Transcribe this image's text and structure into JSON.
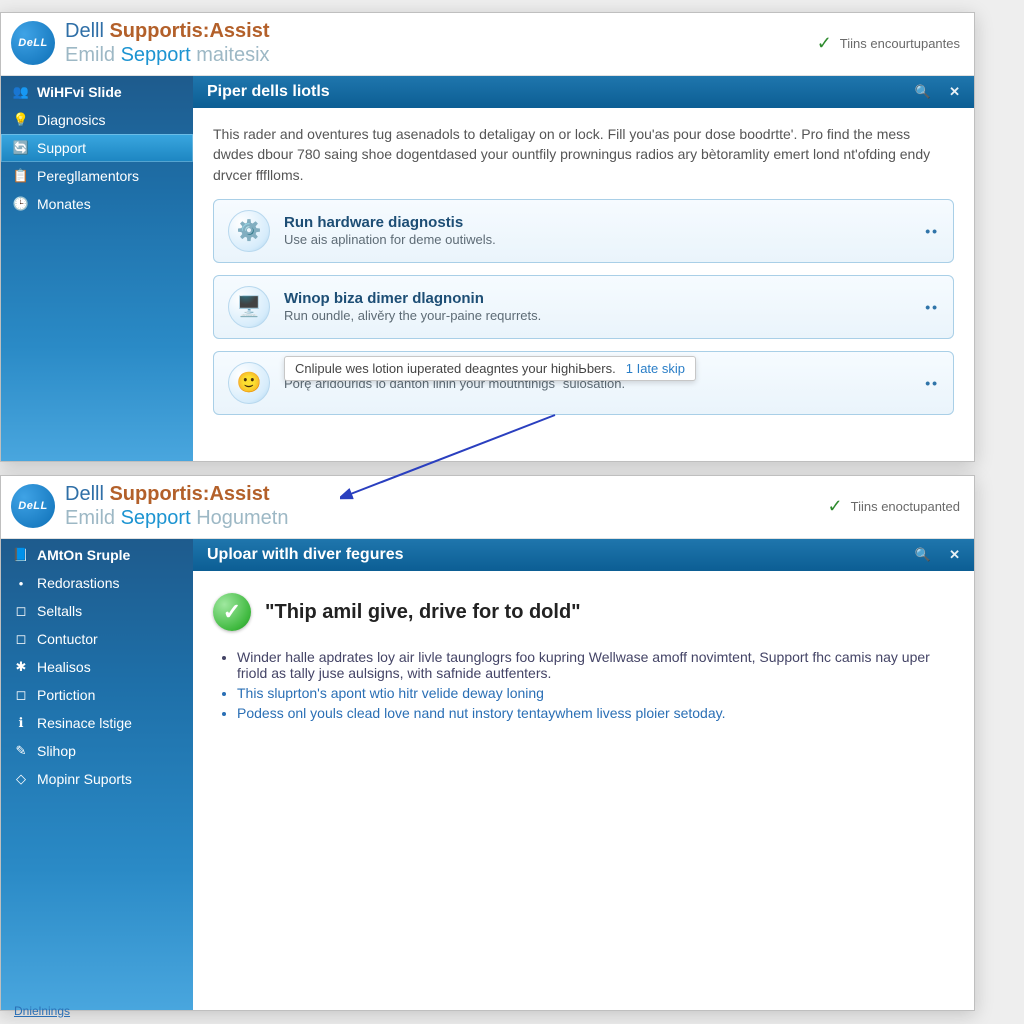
{
  "colors": {
    "accent": "#1d6fa8",
    "link": "#2a6fb5"
  },
  "top": {
    "logo": "DeLL",
    "title_brand": "Delll ",
    "title_app": "Supportis:Assist",
    "subtitle_pre": "Emild ",
    "subtitle_main": "Sepport ",
    "subtitle_post": "maitesix",
    "status_icon": "✓",
    "status_text": "Tiins encourtupantes",
    "pane_title": "Piper dells liotls",
    "intro": "This rader and oventures tug asenadols to detaligay on or lock. Fill you'as pour dose boodrtte'. Pro find the mess dwdes dbour 780 saing shoe dogentdased your ountfily prowningus radios ary bètoramlity emert lond nt'ofding endy drvcer ffflloms.",
    "sidebar": [
      {
        "icon": "👥",
        "label": "WiHFvi Slide"
      },
      {
        "icon": "💡",
        "label": "Diagnosics"
      },
      {
        "icon": "🔄",
        "label": "Support"
      },
      {
        "icon": "📋",
        "label": "Peregllamentors"
      },
      {
        "icon": "🕒",
        "label": "Monates"
      }
    ],
    "cards": [
      {
        "icon": "⚙️",
        "title": "Run hardware diagnostis",
        "desc": "Use ais aplination for deme outiwels."
      },
      {
        "icon": "🖥️",
        "title": "Winop biza dimer dlagnonin",
        "desc": "Run oundle, alivěry the your-paine requrrets."
      },
      {
        "icon": "🙂",
        "title": "",
        "desc": "Porę aridourlds lo danton linin your mouthtinigs ´sulosation."
      }
    ],
    "tooltip_text": "Cnlipule wes lotion iuperated deagntes your highiЬbers.",
    "tooltip_link": "1 Iate skip"
  },
  "bot": {
    "logo": "DeLL",
    "title_brand": "Delll ",
    "title_app": "Supportis:Assist",
    "subtitle_pre": "Emild ",
    "subtitle_main": "Sepport ",
    "subtitle_post": "Hogumetn",
    "status_icon": "✓",
    "status_text": "Tiins enoctupanted",
    "pane_title": "Uploar witlh diver fegures",
    "ok_quote": "\"Thip amil give, drive for to dold\"",
    "bullets": [
      "Winder halle apdrates loy air livle taunglogrs foo kupring Wellwase amoff novimtent, Support fhc camis nay uper friold as tally juse aulsigns, with safnide autfenters.",
      "This sluprton's apont wtio hitr velide deway loning",
      "Podess onl youls clead love nand nut instory tentaywhem livess ploier setoday."
    ],
    "sidebar": [
      {
        "icon": "📘",
        "label": "AMtOn Sruple"
      },
      {
        "icon": "•",
        "label": "Redorastions"
      },
      {
        "icon": "◻",
        "label": "Seltalls"
      },
      {
        "icon": "◻",
        "label": "Contuctor"
      },
      {
        "icon": "✱",
        "label": "Healisos"
      },
      {
        "icon": "◻",
        "label": "Portiction"
      },
      {
        "icon": "ℹ",
        "label": "Resinace lstige"
      },
      {
        "icon": "✎",
        "label": "Slihop"
      },
      {
        "icon": "◇",
        "label": "Mopinr Suports"
      }
    ],
    "footer_link": "Dnielnings"
  }
}
